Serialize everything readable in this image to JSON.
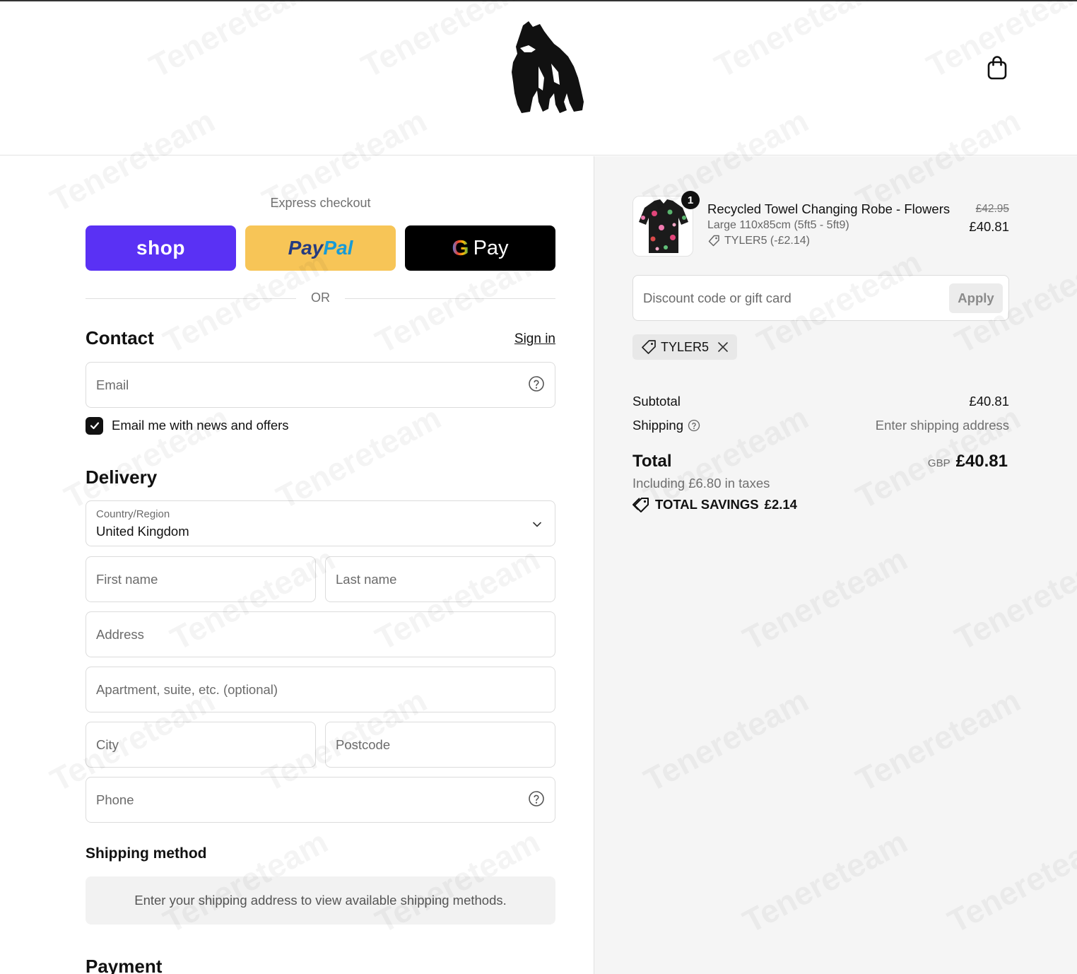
{
  "header": {
    "logo_icon": "gorilla-logo-icon",
    "cart_icon": "shopping-bag-icon"
  },
  "express": {
    "title": "Express checkout",
    "shop_label": "shop",
    "paypal_part1": "Pay",
    "paypal_part2": "Pal",
    "gpay_g": "G",
    "gpay_label": "Pay",
    "or_label": "OR"
  },
  "contact": {
    "heading": "Contact",
    "sign_in": "Sign in",
    "email_placeholder": "Email",
    "newsletter_label": "Email me with news and offers",
    "newsletter_checked": true
  },
  "delivery": {
    "heading": "Delivery",
    "country_label": "Country/Region",
    "country_value": "United Kingdom",
    "first_name": "First name",
    "last_name": "Last name",
    "address": "Address",
    "apartment": "Apartment, suite, etc. (optional)",
    "city": "City",
    "postcode": "Postcode",
    "phone": "Phone"
  },
  "shipping_method": {
    "heading": "Shipping method",
    "message": "Enter your shipping address to view available shipping methods."
  },
  "payment": {
    "heading": "Payment"
  },
  "summary": {
    "product": {
      "quantity": "1",
      "name": "Recycled Towel Changing Robe - Flowers",
      "variant": "Large 110x85cm (5ft5 - 5ft9)",
      "discount": "TYLER5 (-£2.14)",
      "old_price": "£42.95",
      "price": "£40.81"
    },
    "discount_placeholder": "Discount code or gift card",
    "apply_label": "Apply",
    "applied_code": "TYLER5",
    "subtotal_label": "Subtotal",
    "subtotal_value": "£40.81",
    "shipping_label": "Shipping",
    "shipping_value": "Enter shipping address",
    "total_label": "Total",
    "currency": "GBP",
    "total_value": "£40.81",
    "taxes": "Including £6.80 in taxes",
    "savings_label": "TOTAL SAVINGS",
    "savings_value": "£2.14"
  },
  "watermark": "Tenereteam",
  "colors": {
    "shop": "#5a31f4",
    "paypal": "#f7c557",
    "gpay": "#000000",
    "summary_bg": "#f5f5f5"
  }
}
